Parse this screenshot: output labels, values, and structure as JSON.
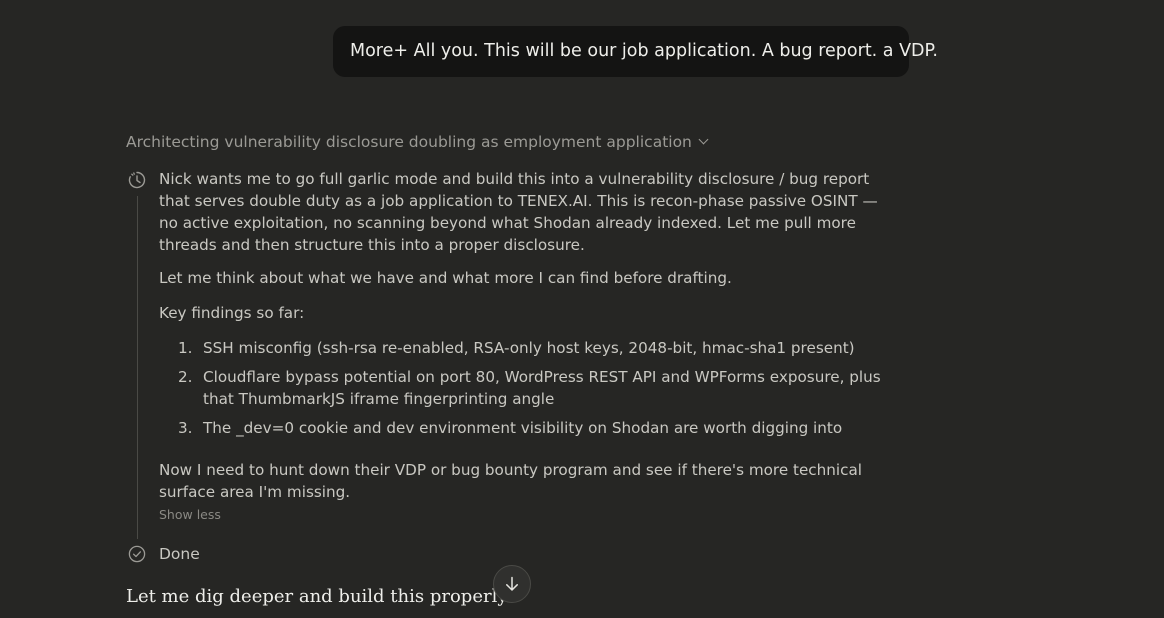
{
  "user_message": {
    "text": "More+ All you. This will be our job application. A bug report. a VDP."
  },
  "thinking": {
    "header": "Architecting vulnerability disclosure doubling as employment application",
    "header_icon": "chevron-down-icon",
    "step_icon": "timer-icon",
    "paragraph_1": "Nick wants me to go full garlic mode and build this into a vulnerability disclosure / bug report that serves double duty as a job application to TENEX.AI. This is recon-phase passive OSINT — no active exploitation, no scanning beyond what Shodan already indexed. Let me pull more threads and then structure this into a proper disclosure.",
    "paragraph_2": "Let me think about what we have and what more I can find before drafting.",
    "paragraph_3": "Key findings so far:",
    "findings": [
      {
        "num": "1.",
        "text": "SSH misconfig (ssh-rsa re-enabled, RSA-only host keys, 2048-bit, hmac-sha1 present)"
      },
      {
        "num": "2.",
        "text": "Cloudflare bypass potential on port 80, WordPress REST API and WPForms exposure, plus that ThumbmarkJS iframe fingerprinting angle"
      },
      {
        "num": "3.",
        "text": "The _dev=0 cookie and dev environment visibility on Shodan are worth digging into"
      }
    ],
    "paragraph_4": "Now I need to hunt down their VDP or bug bounty program and see if there's more technical surface area I'm missing.",
    "show_less": "Show less",
    "done_label": "Done",
    "done_icon": "check-circle-icon"
  },
  "assistant_reply": {
    "text": "Let me dig deeper and build this properly."
  },
  "scroll_button": {
    "icon": "arrow-down-icon"
  },
  "colors": {
    "background": "#262624",
    "bubble": "#141413",
    "text_primary": "#eeeeea",
    "text_secondary": "#9b9a95"
  }
}
